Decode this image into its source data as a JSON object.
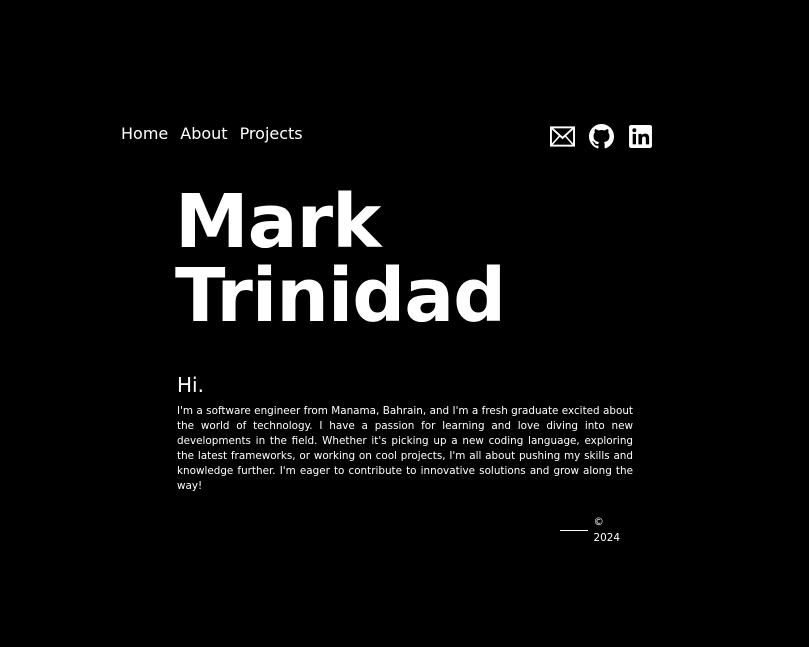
{
  "nav": {
    "home": "Home",
    "about": "About",
    "projects": "Projects"
  },
  "social": {
    "icons": [
      "mail-icon",
      "github-icon",
      "linkedin-icon"
    ]
  },
  "hero": {
    "first_name": "Mark",
    "last_name": "Trinidad"
  },
  "about": {
    "greeting": "Hi.",
    "bio": "I'm a software engineer from Manama, Bahrain, and I'm a fresh graduate excited about the world of technology. I have a passion for learning and love diving into new developments in the field. Whether it's picking up a new coding language, exploring the latest frameworks, or working on cool projects, I'm all about pushing my skills and knowledge further. I'm eager to contribute to innovative solutions and grow along the way!"
  },
  "footer": {
    "copyright": "© 2024"
  },
  "colors": {
    "background": "#000000",
    "text": "#ffffff"
  }
}
